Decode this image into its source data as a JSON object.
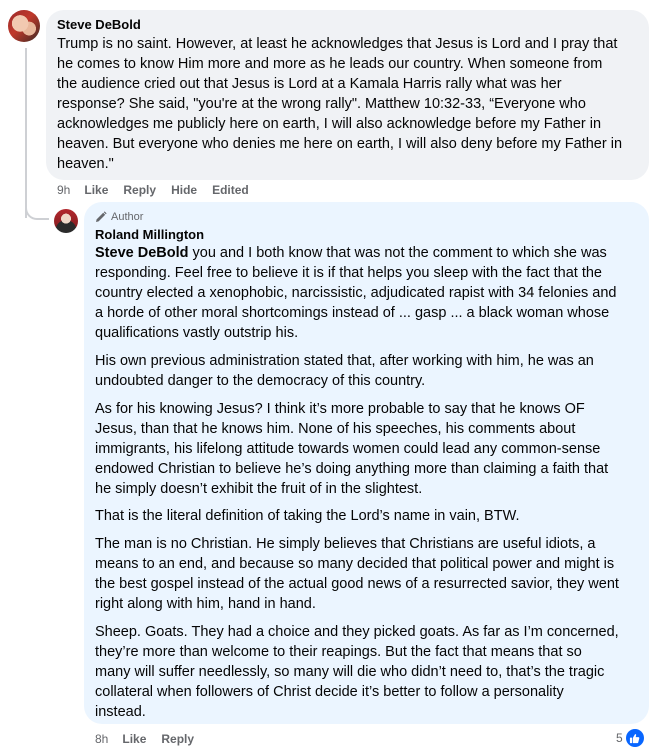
{
  "comment": {
    "author": "Steve DeBold",
    "lines": [
      "Trump is no saint. However, at least he acknowledges that Jesus is Lord and I pray that",
      "he comes to know Him more and more as he leads our country. When someone from",
      "the audience cried out that Jesus is Lord at a Kamala Harris rally what was her",
      "response? She said, \"you're at the wrong rally\". Matthew 10:32-33, “Everyone who",
      "acknowledges me publicly here on earth, I will also acknowledge before my Father in",
      "heaven. But everyone who denies me here on earth, I will also deny before my Father in",
      "heaven.\""
    ],
    "actions": {
      "time": "9h",
      "like": "Like",
      "reply": "Reply",
      "hide": "Hide",
      "edited": "Edited"
    }
  },
  "reply": {
    "badge": "Author",
    "author": "Roland Millington",
    "mention": "Steve DeBold",
    "p1": [
      " you and I both know that was not the comment to which she was",
      "responding. Feel free to believe it is if that helps you sleep with the fact that the",
      "country elected a xenophobic, narcissistic, adjudicated rapist with 34 felonies and",
      "a horde of other moral shortcomings instead of ... gasp ... a black woman whose",
      "qualifications vastly outstrip his."
    ],
    "p2": [
      "His own previous administration stated that, after working with him, he was an",
      "undoubted danger to the democracy of this country."
    ],
    "p3": [
      "As for his knowing Jesus? I think it’s more probable to say that he knows OF",
      "Jesus, than that he knows him. None of his speeches, his comments about",
      "immigrants, his lifelong attitude towards women could lead any common-sense",
      "endowed Christian to believe he’s doing anything more than claiming a faith that",
      "he simply doesn’t exhibit the fruit of in the slightest."
    ],
    "p4": [
      "That is the literal definition of taking the Lord’s name in vain, BTW."
    ],
    "p5": [
      "The man is no Christian. He simply believes that Christians are useful idiots, a",
      "means to an end, and because so many decided that political power and might is",
      "the best gospel instead of the actual good news of a resurrected savior, they went",
      "right along with him, hand in hand."
    ],
    "p6": [
      "Sheep. Goats. They had a choice and they picked goats. As far as I’m concerned,",
      "they’re more than welcome to their reapings. But the fact that means that so",
      "many will suffer needlessly, so many will die who didn’t need to, that’s the tragic",
      "collateral when followers of Christ decide it’s better to follow a personality",
      "instead."
    ],
    "actions": {
      "time": "8h",
      "like": "Like",
      "reply": "Reply"
    },
    "reaction_count": "5"
  }
}
